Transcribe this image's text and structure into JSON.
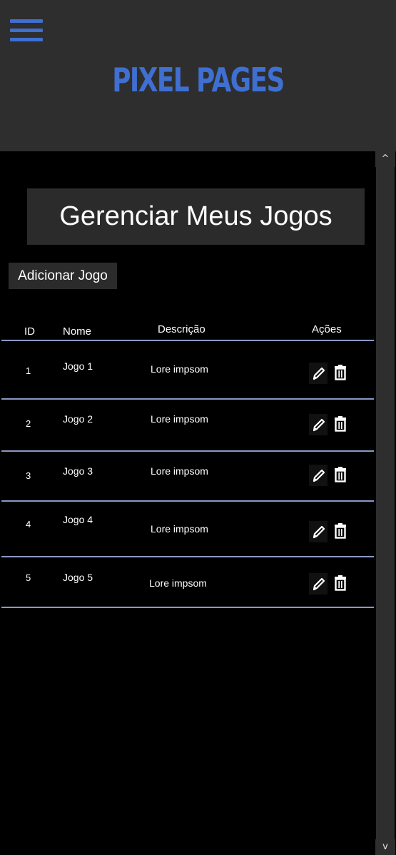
{
  "header": {
    "brand": "PIXEL PAGES",
    "menu_icon": "hamburger-menu-icon",
    "accent_color": "#3f6fd1"
  },
  "page": {
    "title": "Gerenciar Meus Jogos",
    "add_button_label": "Adicionar Jogo"
  },
  "table": {
    "columns": {
      "id": "ID",
      "name": "Nome",
      "description": "Descrição",
      "actions": "Ações"
    },
    "rows": [
      {
        "id": "1",
        "name": "Jogo 1",
        "description": "Lore impsom"
      },
      {
        "id": "2",
        "name": "Jogo 2",
        "description": "Lore impsom"
      },
      {
        "id": "3",
        "name": "Jogo 3",
        "description": "Lore impsom"
      },
      {
        "id": "4",
        "name": "Jogo 4",
        "description": "Lore impsom"
      },
      {
        "id": "5",
        "name": "Jogo 5",
        "description": "Lore impsom"
      }
    ],
    "action_icons": [
      "pencil-edit-icon",
      "trash-delete-icon"
    ]
  },
  "scrollbar": {
    "up_arrow": "^",
    "down_arrow": "v"
  }
}
